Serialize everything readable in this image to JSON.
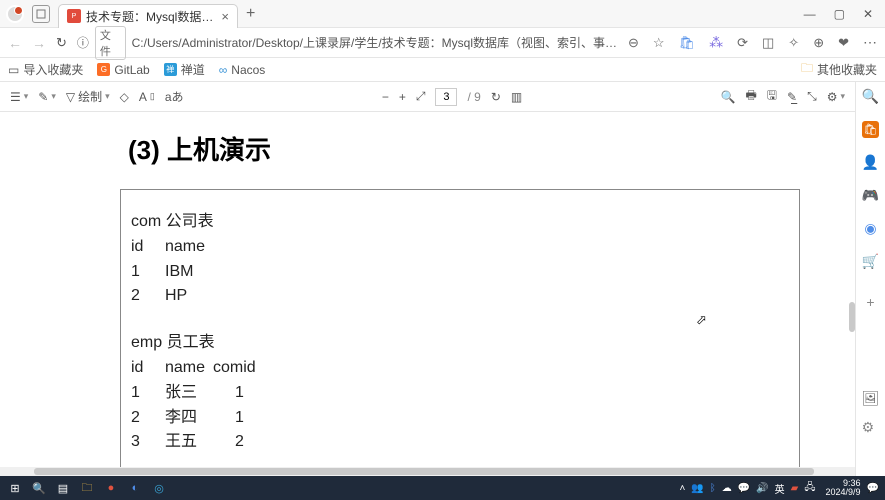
{
  "tab": {
    "title": "技术专题：Mysql数据库（视图"
  },
  "window": {
    "min": "—",
    "max": "▢",
    "close": "✕"
  },
  "address": {
    "file_label": "文件",
    "url": "C:/Users/Administrator/Desktop/上课录屏/学生/技术专题：Mysql数据库（视图、索引、事务）.pdf"
  },
  "bookmarks": {
    "import": "导入收藏夹",
    "gitlab": "GitLab",
    "zen": "禅道",
    "nacos": "Nacos",
    "other": "其他收藏夹"
  },
  "pdf_toolbar": {
    "draw": "绘制",
    "page_current": "3",
    "page_total": "/ 9"
  },
  "document": {
    "heading": "(3)  上机演示",
    "com_title": "com 公司表",
    "com_hdr_id": "id",
    "com_hdr_name": "name",
    "com_r1_id": "1",
    "com_r1_name": "IBM",
    "com_r2_id": "2",
    "com_r2_name": "HP",
    "emp_title": "emp 员工表",
    "emp_hdr_id": "id",
    "emp_hdr_name": "name",
    "emp_hdr_comid": "comid",
    "emp_r1_id": "1",
    "emp_r1_name": "张三",
    "emp_r1_comid": "1",
    "emp_r2_id": "2",
    "emp_r2_name": "李四",
    "emp_r2_comid": "1",
    "emp_r3_id": "3",
    "emp_r3_name": "王五",
    "emp_r3_comid": "2"
  },
  "taskbar": {
    "ime": "英",
    "time": "9:36",
    "date": "2024/9/9"
  }
}
